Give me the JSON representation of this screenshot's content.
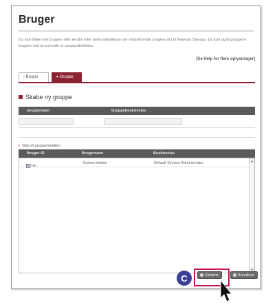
{
  "page": {
    "title": "Bruger",
    "description": "Du kan tilføje nye brugere eller ændre eller slette indstillinger om eksisterende brugere af LG Network Storage. Du kan også gruppere brugere ved at anvende en gruppedefinition.",
    "help_link": "[Se Help for flere oplysninger]"
  },
  "tabs": [
    {
      "label": "Bruger",
      "icon": "arrow-right-icon"
    },
    {
      "label": "Gruppe",
      "icon": "arrow-down-icon"
    }
  ],
  "section": {
    "title": "Skabe ny gruppe",
    "columns": [
      "Gruppenavn",
      "Gruppebeskrivelse"
    ],
    "group_name_value": "",
    "group_description_value": ""
  },
  "members": {
    "label": "Valg af gruppemedlem",
    "columns": [
      "Bruger-ID",
      "Brugernavn",
      "Beskrivelse"
    ],
    "rows": [
      {
        "id": "admin",
        "name": "System Admin",
        "description": "Default System Administrator"
      }
    ]
  },
  "buttons": {
    "save": "Gemme",
    "cancel": "Annullere"
  },
  "callout": {
    "label": "C",
    "color": "#3b3f93"
  },
  "colors": {
    "accent": "#8d2230",
    "highlight": "#c2185b",
    "header_bar": "#5a5a5a"
  }
}
